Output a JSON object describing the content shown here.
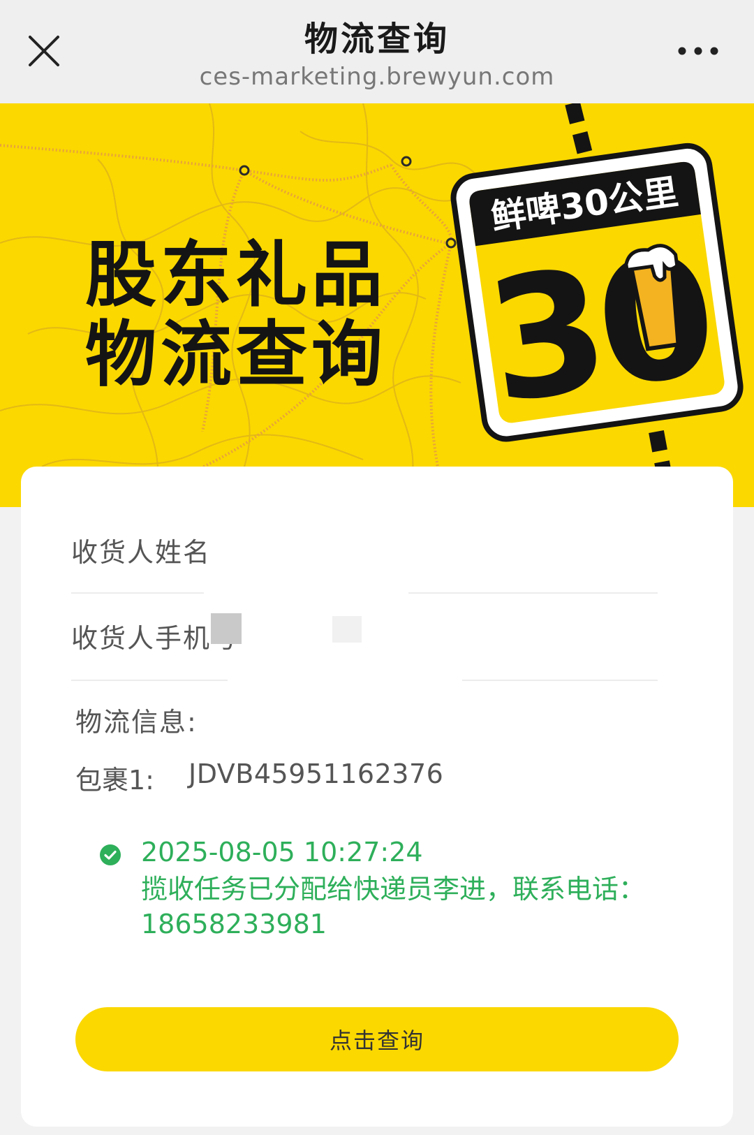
{
  "nav": {
    "title": "物流查询",
    "url": "ces-marketing.brewyun.com",
    "close_icon": "close-icon",
    "more_icon": "more-dots-icon"
  },
  "banner": {
    "title_line1": "股东礼品",
    "title_line2": "物流查询",
    "sign_text": "鲜啤30公里",
    "sign_number": "30",
    "colors": {
      "background": "#fbd800",
      "sign": "#fbd800",
      "dark": "#141414",
      "route": "#e8a33a"
    }
  },
  "form": {
    "name_label": "收货人姓名",
    "phone_label": "收货人手机号"
  },
  "logistics": {
    "info_label": "物流信息:",
    "package_label": "包裹1:",
    "package_number": "JDVB45951162376",
    "tracking": {
      "time": "2025-08-05 10:27:24",
      "description": "揽收任务已分配给快递员李进，联系电话：18658233981",
      "status_icon": "check-circle-icon",
      "color": "#2eaf5a"
    }
  },
  "button": {
    "query_label": "点击查询",
    "color": "#fbd800"
  }
}
